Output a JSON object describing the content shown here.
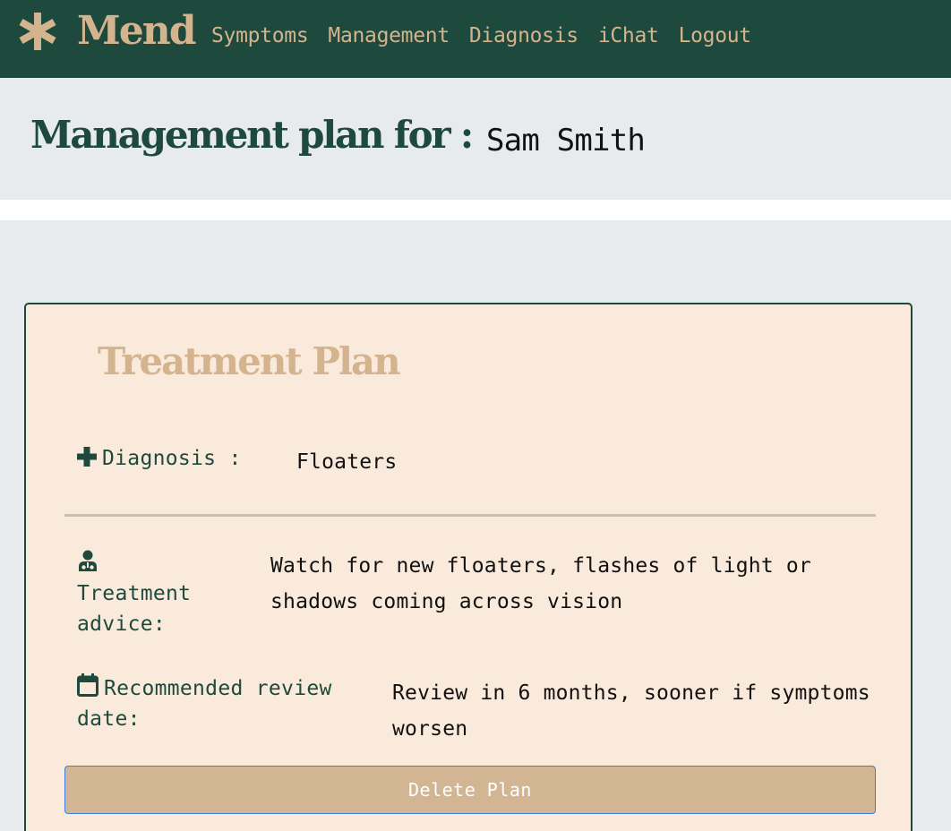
{
  "app": {
    "name": "Mend",
    "logo_icon": "asterisk-icon"
  },
  "nav": {
    "items": [
      {
        "label": "Symptoms"
      },
      {
        "label": "Management"
      },
      {
        "label": "Diagnosis"
      },
      {
        "label": "iChat"
      },
      {
        "label": "Logout"
      }
    ]
  },
  "header": {
    "label": "Management plan for :",
    "patient_name": "Sam Smith"
  },
  "card": {
    "title": "Treatment Plan",
    "diagnosis": {
      "icon": "plus-icon",
      "label": "Diagnosis :",
      "value": "Floaters"
    },
    "treatment": {
      "icon": "doctor-icon",
      "label": "Treatment advice:",
      "value": "Watch for new floaters, flashes of light or shadows coming across vision"
    },
    "review": {
      "icon": "calendar-icon",
      "label": "Recommended review date:",
      "value": "Review in 6 months, sooner if symptoms worsen"
    },
    "delete_label": "Delete Plan"
  },
  "colors": {
    "navbar_bg": "#1d4a3c",
    "accent": "#d4b48e",
    "page_bg": "#e7ebee",
    "card_bg": "#faeadb",
    "button_bg": "#d2b593"
  }
}
